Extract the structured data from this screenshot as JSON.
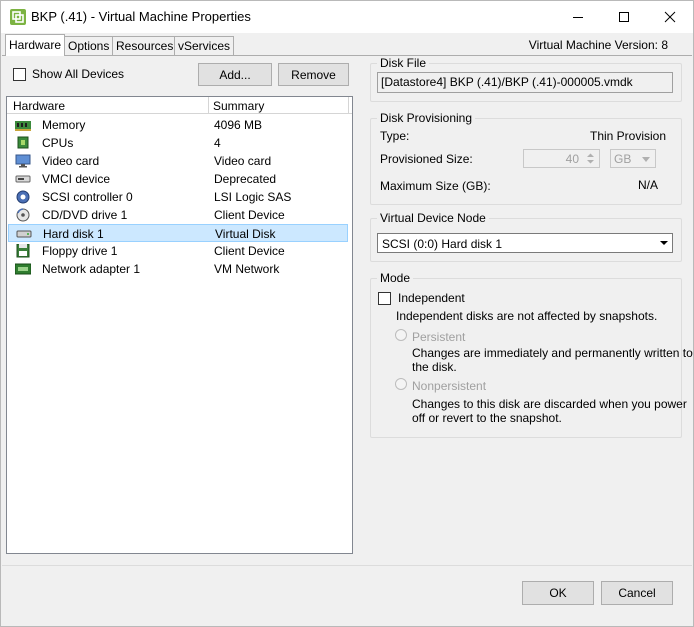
{
  "window": {
    "title": "BKP (.41) - Virtual Machine Properties"
  },
  "tabs": [
    {
      "label": "Hardware"
    },
    {
      "label": "Options"
    },
    {
      "label": "Resources"
    },
    {
      "label": "vServices"
    }
  ],
  "vm_version": "Virtual Machine Version: 8",
  "left": {
    "show_all_label": "Show All Devices",
    "add_button": "Add...",
    "remove_button": "Remove",
    "table": {
      "col_hardware": "Hardware",
      "col_summary": "Summary",
      "rows": [
        {
          "name": "Memory",
          "summary": "4096 MB",
          "icon": "memory-icon"
        },
        {
          "name": "CPUs",
          "summary": "4",
          "icon": "cpu-icon"
        },
        {
          "name": "Video card",
          "summary": "Video card",
          "icon": "video-card-icon"
        },
        {
          "name": "VMCI device",
          "summary": "Deprecated",
          "icon": "vmci-device-icon"
        },
        {
          "name": "SCSI controller 0",
          "summary": "LSI Logic SAS",
          "icon": "scsi-controller-icon"
        },
        {
          "name": "CD/DVD drive 1",
          "summary": "Client Device",
          "icon": "cd-dvd-icon"
        },
        {
          "name": "Hard disk 1",
          "summary": "Virtual Disk",
          "icon": "hard-disk-icon"
        },
        {
          "name": "Floppy drive 1",
          "summary": "Client Device",
          "icon": "floppy-drive-icon"
        },
        {
          "name": "Network adapter 1",
          "summary": "VM Network",
          "icon": "network-adapter-icon"
        }
      ]
    }
  },
  "disk_file": {
    "title": "Disk File",
    "value": "[Datastore4] BKP (.41)/BKP (.41)-000005.vmdk"
  },
  "disk_provisioning": {
    "title": "Disk Provisioning",
    "type_label": "Type:",
    "type_value": "Thin Provision",
    "provisioned_label": "Provisioned Size:",
    "provisioned_value": "40",
    "unit": "GB",
    "max_label": "Maximum Size (GB):",
    "max_value": "N/A"
  },
  "virtual_device_node": {
    "title": "Virtual Device Node",
    "selected": "SCSI (0:0) Hard disk 1"
  },
  "mode": {
    "title": "Mode",
    "independent_label": "Independent",
    "independent_desc": "Independent disks are not affected by snapshots.",
    "persistent_label": "Persistent",
    "persistent_desc_1": "Changes are immediately and permanently written to",
    "persistent_desc_2": "the disk.",
    "nonpersistent_label": "Nonpersistent",
    "nonpersistent_desc_1": "Changes to this disk are discarded when you power",
    "nonpersistent_desc_2": "off or revert to the snapshot."
  },
  "footer": {
    "ok": "OK",
    "cancel": "Cancel"
  },
  "colors": {
    "selection": "#cce8ff",
    "selection_border": "#99d1ff",
    "window_bg": "#f0f0f0"
  }
}
